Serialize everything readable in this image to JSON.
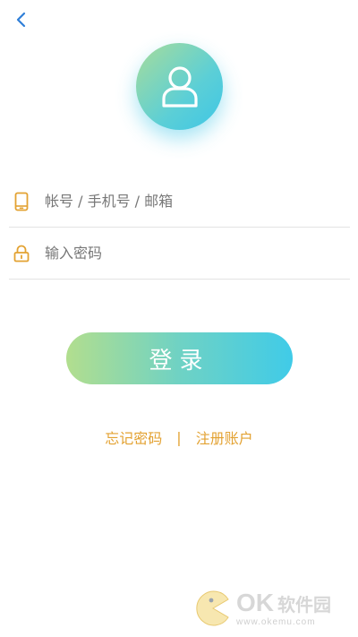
{
  "header": {
    "back_icon": "chevron-left-icon"
  },
  "avatar": {
    "icon": "user-icon"
  },
  "form": {
    "account": {
      "icon": "phone-icon",
      "value": "",
      "placeholder": "帐号 / 手机号 / 邮箱"
    },
    "password": {
      "icon": "lock-icon",
      "value": "",
      "placeholder": "输入密码"
    },
    "login_label": "登录"
  },
  "links": {
    "forgot_password": "忘记密码",
    "separator": "|",
    "register": "注册账户"
  },
  "watermark": {
    "logo": "OK",
    "name": "软件园",
    "url": "www.okemu.com"
  },
  "colors": {
    "accent_blue": "#2f7fd8",
    "link_gold": "#e3a232",
    "gradient_start": "#b2de8e",
    "gradient_end": "#40cbe8",
    "divider": "#e3e3e3"
  }
}
